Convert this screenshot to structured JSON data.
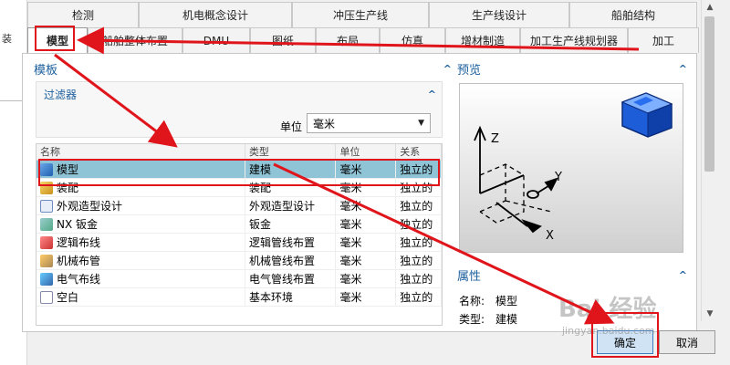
{
  "background": {
    "left_label": "装"
  },
  "tabs_row1": [
    "检测",
    "机电概念设计",
    "冲压生产线",
    "生产线设计",
    "船舶结构"
  ],
  "tabs_row2": [
    "模型",
    "船舶整体布置",
    "DMU",
    "图纸",
    "布局",
    "仿真",
    "增材制造",
    "加工生产线规划器",
    "加工"
  ],
  "active_tab": "模型",
  "template_section": {
    "title": "模板",
    "collapse": "^"
  },
  "filter": {
    "title": "过滤器",
    "collapse": "^",
    "unit_label": "单位",
    "unit_value": "毫米",
    "dropdown_icon": "▼"
  },
  "table": {
    "headers": [
      "名称",
      "类型",
      "单位",
      "关系"
    ],
    "rows": [
      {
        "name": "模型",
        "type": "建模",
        "unit": "毫米",
        "relation": "独立的",
        "icon": "model-icon",
        "selected": true
      },
      {
        "name": "装配",
        "type": "装配",
        "unit": "毫米",
        "relation": "独立的",
        "icon": "assembly-icon"
      },
      {
        "name": "外观造型设计",
        "type": "外观造型设计",
        "unit": "毫米",
        "relation": "独立的",
        "icon": "shape-studio-icon"
      },
      {
        "name": "NX 钣金",
        "type": "钣金",
        "unit": "毫米",
        "relation": "独立的",
        "icon": "sheet-metal-icon"
      },
      {
        "name": "逻辑布线",
        "type": "逻辑管线布置",
        "unit": "毫米",
        "relation": "独立的",
        "icon": "logical-routing-icon"
      },
      {
        "name": "机械布管",
        "type": "机械管线布置",
        "unit": "毫米",
        "relation": "独立的",
        "icon": "mechanical-routing-icon"
      },
      {
        "name": "电气布线",
        "type": "电气管线布置",
        "unit": "毫米",
        "relation": "独立的",
        "icon": "electrical-routing-icon"
      },
      {
        "name": "空白",
        "type": "基本环境",
        "unit": "毫米",
        "relation": "独立的",
        "icon": "blank-icon"
      }
    ]
  },
  "preview": {
    "title": "预览",
    "collapse": "^",
    "axis_z": "Z",
    "axis_y": "Y",
    "axis_x": "X"
  },
  "properties": {
    "title": "属性",
    "collapse": "^",
    "name_key": "名称:",
    "name_value": "模型",
    "type_key": "类型:",
    "type_value": "建模"
  },
  "buttons": {
    "ok": "确定",
    "cancel": "取消"
  },
  "watermark": {
    "main": "Bai 经验",
    "sub": "jingyan.baidu.com"
  },
  "colors": {
    "annotation": "#e0141b",
    "selected_row": "#8fc3d6",
    "section_title": "#1b5f9e"
  }
}
